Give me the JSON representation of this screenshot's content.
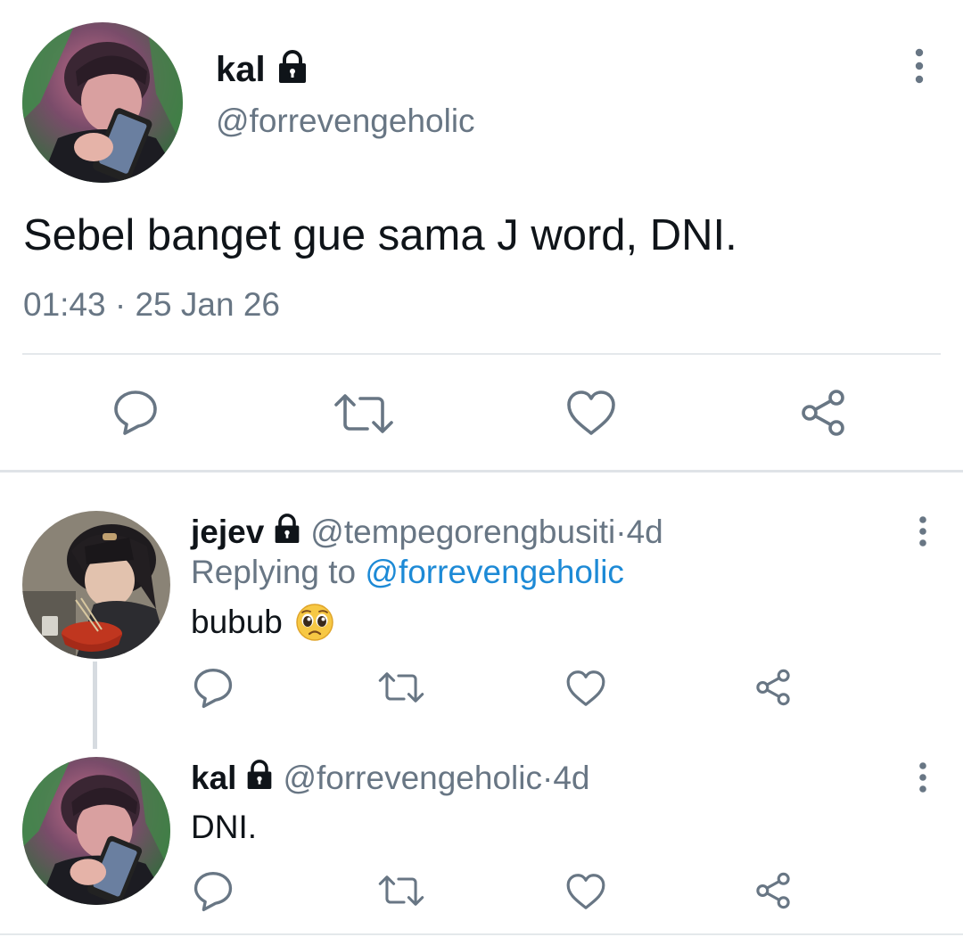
{
  "main_tweet": {
    "name": "kal",
    "handle": "@forrevengeholic",
    "text": "Sebel banget gue sama J word, DNI.",
    "time": "01:43",
    "date": "25 Jan 26",
    "timestamp_sep": " · "
  },
  "replies": [
    {
      "name": "jejev",
      "handle": "@tempegorengbusiti",
      "age": "4d",
      "replying_label": "Replying to",
      "replying_handle": "@forrevengeholic",
      "text": "bubub",
      "emoji": "pleading-face-emoji"
    },
    {
      "name": "kal",
      "handle": "@forrevengeholic",
      "age": "4d",
      "text": "DNI."
    }
  ],
  "meta_sep": " · ",
  "icons": {
    "lock": "lock-icon",
    "more": "more-vertical-icon",
    "reply": "reply-icon",
    "retweet": "retweet-icon",
    "like": "heart-icon",
    "share": "share-icon"
  },
  "colors": {
    "text": "#0f1419",
    "secondary": "#687684",
    "link": "#1d8ad6",
    "divider": "#e4e8eb"
  }
}
